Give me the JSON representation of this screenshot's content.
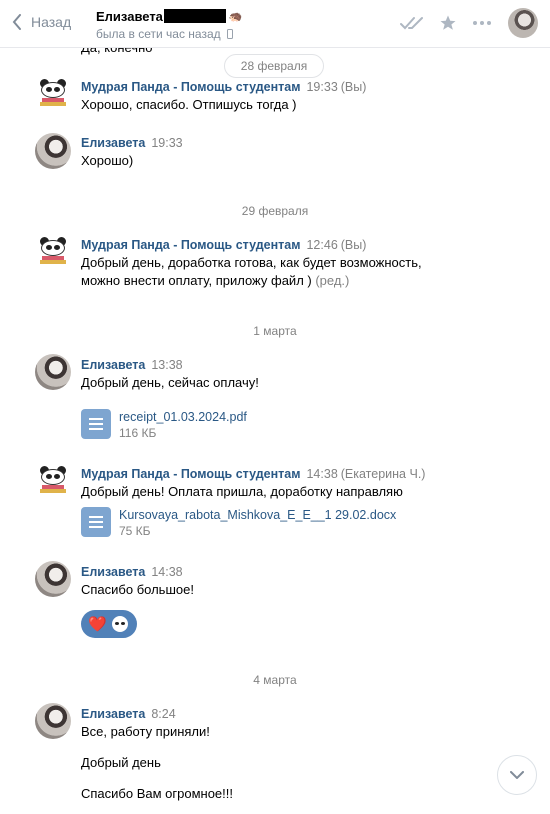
{
  "header": {
    "back_label": "Назад",
    "peer_name": "Елизавета",
    "peer_status": "была в сети час назад",
    "hedgehog_emoji": "🦔"
  },
  "top_cut_message": "Да, конечно",
  "floating_date": "28 февраля",
  "dates": {
    "feb29": "29 февраля",
    "mar1": "1 марта",
    "mar4": "4 марта"
  },
  "messages": [
    {
      "author": "Мудрая Панда - Помощь студентам",
      "time": "19:33",
      "extra": "(Вы)",
      "lines": [
        "Хорошо, спасибо. Отпишусь тогда )"
      ]
    },
    {
      "author": "Елизавета",
      "time": "19:33",
      "lines": [
        "Хорошо)"
      ]
    },
    {
      "author": "Мудрая Панда - Помощь студентам",
      "time": "12:46",
      "extra": "(Вы)",
      "lines": [
        "Добрый день, доработка готова, как будет возможность,",
        "можно внести оплату, приложу файл )"
      ],
      "edited": "(ред.)"
    },
    {
      "author": "Елизавета",
      "time": "13:38",
      "lines": [
        "Добрый день, сейчас оплачу!"
      ],
      "file": {
        "name": "receipt_01.03.2024.pdf",
        "size": "116 КБ"
      }
    },
    {
      "author": "Мудрая Панда - Помощь студентам",
      "time": "14:38",
      "extra": "(Екатерина Ч.)",
      "lines": [
        "Добрый день! Оплата пришла, доработку направляю"
      ],
      "file": {
        "name": "Kursovaya_rabota_Mishkova_E_E__1 29.02.docx",
        "size": "75 КБ"
      }
    },
    {
      "author": "Елизавета",
      "time": "14:38",
      "lines": [
        "Спасибо большое!"
      ],
      "reaction": "❤️"
    },
    {
      "author": "Елизавета",
      "time": "8:24",
      "lines": [
        "Все, работу приняли!",
        "Добрый день",
        "Спасибо Вам огромное!!!"
      ]
    }
  ],
  "colors": {
    "author": "#2a5885",
    "muted": "#828282",
    "reaction_bg": "#5181b8",
    "file_icon": "#7ea5d0"
  }
}
